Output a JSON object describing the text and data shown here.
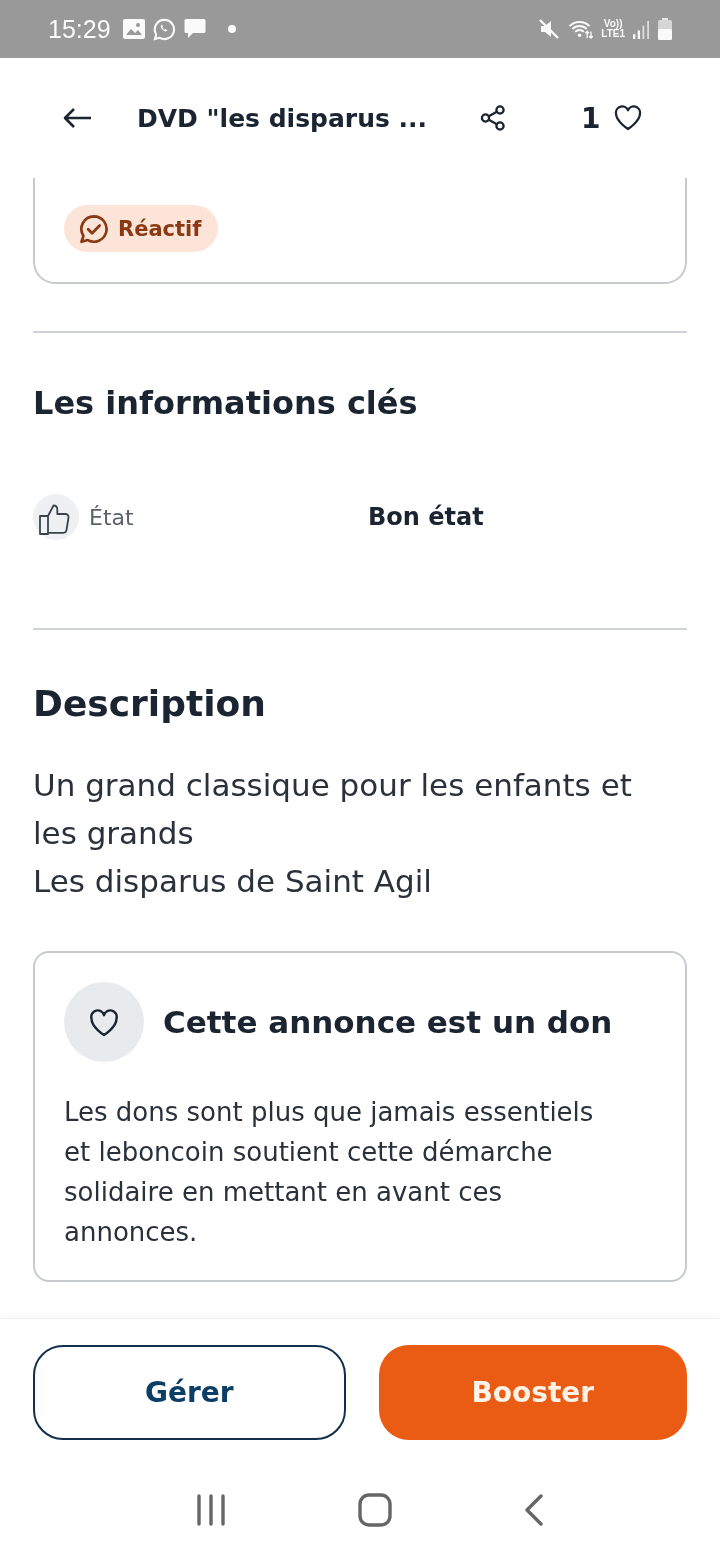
{
  "status_bar": {
    "time": "15:29",
    "network": [
      "Vo))",
      "LTE1"
    ]
  },
  "header": {
    "title": "DVD \"les disparus ...",
    "likes": "1"
  },
  "seller_card": {
    "badge": "Réactif"
  },
  "key_info": {
    "title": "Les informations clés",
    "rows": [
      {
        "label": "État",
        "value": "Bon état"
      }
    ]
  },
  "description": {
    "title": "Description",
    "lines": [
      "Un grand classique pour les enfants et les grands",
      "Les disparus de Saint Agil"
    ]
  },
  "donation_notice": {
    "title": "Cette annonce est un don",
    "text": "Les dons sont plus que jamais essentiels et leboncoin soutient cette démarche solidaire en mettant en avant ces annonces."
  },
  "actions": [
    {
      "label": "Gérer",
      "kind": "secondary"
    },
    {
      "label": "Booster",
      "kind": "primary"
    }
  ]
}
